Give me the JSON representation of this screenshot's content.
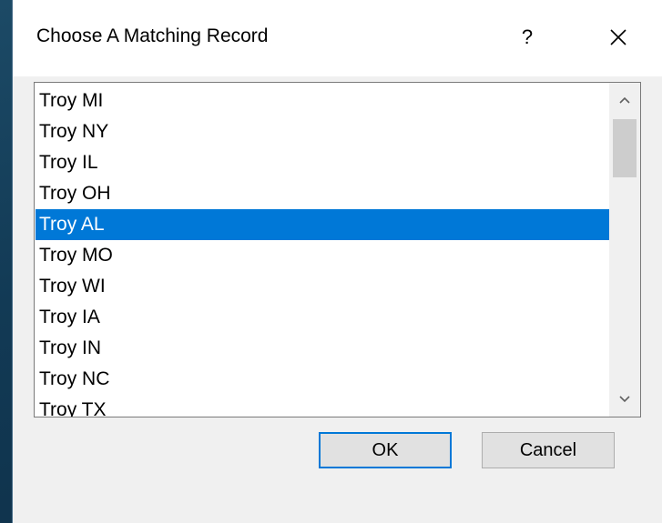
{
  "dialog": {
    "title": "Choose A Matching Record",
    "help_label": "?",
    "close_icon": "close-icon"
  },
  "list": {
    "items": [
      "Troy MI",
      "Troy NY",
      "Troy IL",
      "Troy OH",
      "Troy AL",
      "Troy MO",
      "Troy WI",
      "Troy IA",
      "Troy IN",
      "Troy NC",
      "Troy TX"
    ],
    "selected_index": 4,
    "selection_color": "#0078d7"
  },
  "buttons": {
    "ok_label": "OK",
    "cancel_label": "Cancel"
  }
}
